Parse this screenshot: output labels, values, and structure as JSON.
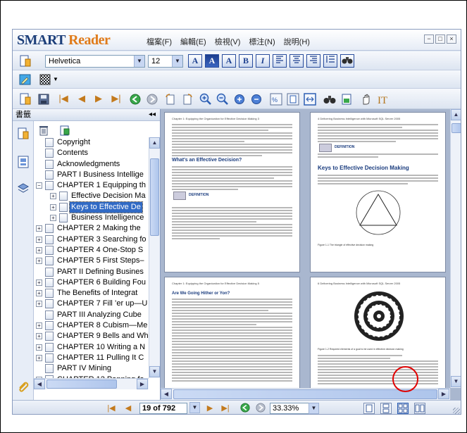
{
  "app": {
    "logo_main": "SMART ",
    "logo_accent": "Reader",
    "menu": [
      "檔案(F)",
      "編輯(E)",
      "檢視(V)",
      "標注(N)",
      "說明(H)"
    ],
    "window_controls": [
      "−",
      "□",
      "×"
    ]
  },
  "toolbar": {
    "font_name": "Helvetica",
    "font_size": "12",
    "format_buttons": [
      "A",
      "A",
      "A",
      "B",
      "I"
    ],
    "align_icons": [
      "align-left-icon",
      "align-center-icon",
      "align-right-icon",
      "align-justify-icon",
      "line-spacing-icon"
    ]
  },
  "sidebar": {
    "title": "書籤",
    "collapse_glyph": "◂◂",
    "bookmarks": [
      {
        "label": "Copyright",
        "level": 1,
        "expander": ""
      },
      {
        "label": "Contents",
        "level": 1,
        "expander": ""
      },
      {
        "label": "Acknowledgments",
        "level": 1,
        "expander": ""
      },
      {
        "label": "PART I Business Intellige",
        "level": 1,
        "expander": ""
      },
      {
        "label": "CHAPTER 1 Equipping th",
        "level": 1,
        "expander": "−"
      },
      {
        "label": "Effective Decision Ma",
        "level": 2,
        "expander": "+"
      },
      {
        "label": "Keys to Effective De",
        "level": 2,
        "expander": "+",
        "selected": true
      },
      {
        "label": "Business Intelligence",
        "level": 2,
        "expander": "+"
      },
      {
        "label": "CHAPTER 2 Making the",
        "level": 1,
        "expander": "+"
      },
      {
        "label": "CHAPTER 3 Searching fo",
        "level": 1,
        "expander": "+"
      },
      {
        "label": "CHAPTER 4 One-Stop S",
        "level": 1,
        "expander": "+"
      },
      {
        "label": "CHAPTER 5 First Steps–",
        "level": 1,
        "expander": "+"
      },
      {
        "label": "PART II Defining Busines",
        "level": 1,
        "expander": ""
      },
      {
        "label": "CHAPTER 6 Building Fou",
        "level": 1,
        "expander": "+"
      },
      {
        "label": "The Benefits of Integrat",
        "level": 1,
        "expander": "+"
      },
      {
        "label": "CHAPTER 7 Fill ’er up—U",
        "level": 1,
        "expander": "+"
      },
      {
        "label": "PART III Analyzing Cube",
        "level": 1,
        "expander": ""
      },
      {
        "label": "CHAPTER 8 Cubism—Me",
        "level": 1,
        "expander": "+"
      },
      {
        "label": "CHAPTER 9 Bells and Wh",
        "level": 1,
        "expander": "+"
      },
      {
        "label": "CHAPTER 10 Writing a N",
        "level": 1,
        "expander": "+"
      },
      {
        "label": "CHAPTER 11 Pulling It C",
        "level": 1,
        "expander": "+"
      },
      {
        "label": "PART IV Mining",
        "level": 1,
        "expander": ""
      },
      {
        "label": "CHAPTER 12 Panning fo",
        "level": 1,
        "expander": "+"
      }
    ]
  },
  "pages": {
    "p1_header": "Chapter 1:  Equipping the Organization for Effective Decision Making    3",
    "p1_heading": "What's an Effective Decision?",
    "p1_definition_label": "DEFINITION",
    "p2_header": "4    Delivering Business Intelligence with Microsoft SQL Server 2005",
    "p2_definition_label": "DEFINITION",
    "p2_heading": "Keys to Effective Decision Making",
    "p2_figure_caption": "Figure 1-1    The triangle of effective decision making",
    "p3_header": "Chapter 1:  Equipping the Organization for Effective Decision Making    5",
    "p3_heading": "Are We Going Hither or Yon?",
    "p4_header": "6    Delivering Business Intelligence with Microsoft SQL Server 2005",
    "p4_figure_caption": "Figure 1-2    Required elements of a goal to be used in effective decision making"
  },
  "statusbar": {
    "page_indicator": "19 of 792",
    "zoom": "33.33%"
  },
  "colors": {
    "accent": "#316ac5",
    "highlight_circle": "#e00000",
    "nav_arrow": "#c37a1d"
  }
}
